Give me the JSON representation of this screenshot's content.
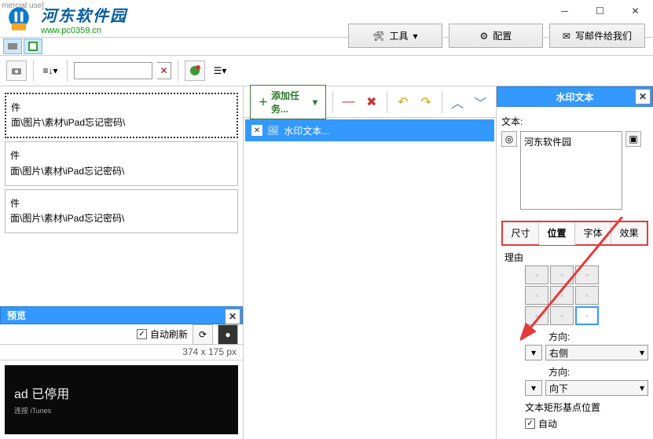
{
  "title_fragment": "mercial use]",
  "logo": {
    "title": "河东软件园",
    "url": "www.pc0359.cn"
  },
  "top_buttons": {
    "tools": "工具",
    "config": "配置",
    "mail": "写邮件给我们"
  },
  "toolbar": {
    "add_task": "添加任务..."
  },
  "list": {
    "items": [
      {
        "line1": "件",
        "line2": "面\\图片\\素材\\iPad忘记密码\\"
      },
      {
        "line1": "件",
        "line2": "面\\图片\\素材\\iPad忘记密码\\"
      },
      {
        "line1": "件",
        "line2": "面\\图片\\素材\\iPad忘记密码\\"
      }
    ]
  },
  "preview": {
    "title": "预览",
    "auto_refresh": "自动刷新",
    "dimensions": "374 x 175 px",
    "img_main": "ad 已停用",
    "img_sub": "连按 iTunes"
  },
  "task_row": {
    "label": "水印文本..."
  },
  "right": {
    "title": "水印文本",
    "text_label": "文本:",
    "text_value": "河东软件园",
    "tabs": {
      "size": "尺寸",
      "position": "位置",
      "font": "字体",
      "effect": "效果"
    },
    "reason_label": "理由",
    "direction_label": "方向:",
    "direction_right": "右侧",
    "direction_down": "向下",
    "rect_base_label": "文本矩形基点位置",
    "auto_label": "自动"
  }
}
